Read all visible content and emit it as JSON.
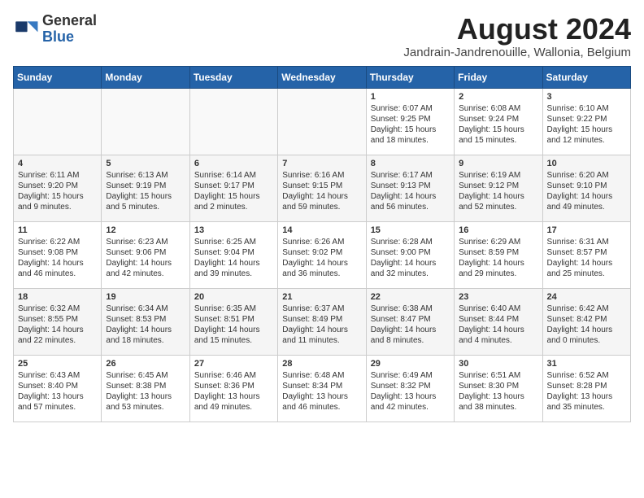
{
  "header": {
    "logo_general": "General",
    "logo_blue": "Blue",
    "title": "August 2024",
    "subtitle": "Jandrain-Jandrenouille, Wallonia, Belgium"
  },
  "days_of_week": [
    "Sunday",
    "Monday",
    "Tuesday",
    "Wednesday",
    "Thursday",
    "Friday",
    "Saturday"
  ],
  "weeks": [
    [
      {
        "day": "",
        "content": ""
      },
      {
        "day": "",
        "content": ""
      },
      {
        "day": "",
        "content": ""
      },
      {
        "day": "",
        "content": ""
      },
      {
        "day": "1",
        "content": "Sunrise: 6:07 AM\nSunset: 9:25 PM\nDaylight: 15 hours and 18 minutes."
      },
      {
        "day": "2",
        "content": "Sunrise: 6:08 AM\nSunset: 9:24 PM\nDaylight: 15 hours and 15 minutes."
      },
      {
        "day": "3",
        "content": "Sunrise: 6:10 AM\nSunset: 9:22 PM\nDaylight: 15 hours and 12 minutes."
      }
    ],
    [
      {
        "day": "4",
        "content": "Sunrise: 6:11 AM\nSunset: 9:20 PM\nDaylight: 15 hours and 9 minutes."
      },
      {
        "day": "5",
        "content": "Sunrise: 6:13 AM\nSunset: 9:19 PM\nDaylight: 15 hours and 5 minutes."
      },
      {
        "day": "6",
        "content": "Sunrise: 6:14 AM\nSunset: 9:17 PM\nDaylight: 15 hours and 2 minutes."
      },
      {
        "day": "7",
        "content": "Sunrise: 6:16 AM\nSunset: 9:15 PM\nDaylight: 14 hours and 59 minutes."
      },
      {
        "day": "8",
        "content": "Sunrise: 6:17 AM\nSunset: 9:13 PM\nDaylight: 14 hours and 56 minutes."
      },
      {
        "day": "9",
        "content": "Sunrise: 6:19 AM\nSunset: 9:12 PM\nDaylight: 14 hours and 52 minutes."
      },
      {
        "day": "10",
        "content": "Sunrise: 6:20 AM\nSunset: 9:10 PM\nDaylight: 14 hours and 49 minutes."
      }
    ],
    [
      {
        "day": "11",
        "content": "Sunrise: 6:22 AM\nSunset: 9:08 PM\nDaylight: 14 hours and 46 minutes."
      },
      {
        "day": "12",
        "content": "Sunrise: 6:23 AM\nSunset: 9:06 PM\nDaylight: 14 hours and 42 minutes."
      },
      {
        "day": "13",
        "content": "Sunrise: 6:25 AM\nSunset: 9:04 PM\nDaylight: 14 hours and 39 minutes."
      },
      {
        "day": "14",
        "content": "Sunrise: 6:26 AM\nSunset: 9:02 PM\nDaylight: 14 hours and 36 minutes."
      },
      {
        "day": "15",
        "content": "Sunrise: 6:28 AM\nSunset: 9:00 PM\nDaylight: 14 hours and 32 minutes."
      },
      {
        "day": "16",
        "content": "Sunrise: 6:29 AM\nSunset: 8:59 PM\nDaylight: 14 hours and 29 minutes."
      },
      {
        "day": "17",
        "content": "Sunrise: 6:31 AM\nSunset: 8:57 PM\nDaylight: 14 hours and 25 minutes."
      }
    ],
    [
      {
        "day": "18",
        "content": "Sunrise: 6:32 AM\nSunset: 8:55 PM\nDaylight: 14 hours and 22 minutes."
      },
      {
        "day": "19",
        "content": "Sunrise: 6:34 AM\nSunset: 8:53 PM\nDaylight: 14 hours and 18 minutes."
      },
      {
        "day": "20",
        "content": "Sunrise: 6:35 AM\nSunset: 8:51 PM\nDaylight: 14 hours and 15 minutes."
      },
      {
        "day": "21",
        "content": "Sunrise: 6:37 AM\nSunset: 8:49 PM\nDaylight: 14 hours and 11 minutes."
      },
      {
        "day": "22",
        "content": "Sunrise: 6:38 AM\nSunset: 8:47 PM\nDaylight: 14 hours and 8 minutes."
      },
      {
        "day": "23",
        "content": "Sunrise: 6:40 AM\nSunset: 8:44 PM\nDaylight: 14 hours and 4 minutes."
      },
      {
        "day": "24",
        "content": "Sunrise: 6:42 AM\nSunset: 8:42 PM\nDaylight: 14 hours and 0 minutes."
      }
    ],
    [
      {
        "day": "25",
        "content": "Sunrise: 6:43 AM\nSunset: 8:40 PM\nDaylight: 13 hours and 57 minutes."
      },
      {
        "day": "26",
        "content": "Sunrise: 6:45 AM\nSunset: 8:38 PM\nDaylight: 13 hours and 53 minutes."
      },
      {
        "day": "27",
        "content": "Sunrise: 6:46 AM\nSunset: 8:36 PM\nDaylight: 13 hours and 49 minutes."
      },
      {
        "day": "28",
        "content": "Sunrise: 6:48 AM\nSunset: 8:34 PM\nDaylight: 13 hours and 46 minutes."
      },
      {
        "day": "29",
        "content": "Sunrise: 6:49 AM\nSunset: 8:32 PM\nDaylight: 13 hours and 42 minutes."
      },
      {
        "day": "30",
        "content": "Sunrise: 6:51 AM\nSunset: 8:30 PM\nDaylight: 13 hours and 38 minutes."
      },
      {
        "day": "31",
        "content": "Sunrise: 6:52 AM\nSunset: 8:28 PM\nDaylight: 13 hours and 35 minutes."
      }
    ]
  ]
}
